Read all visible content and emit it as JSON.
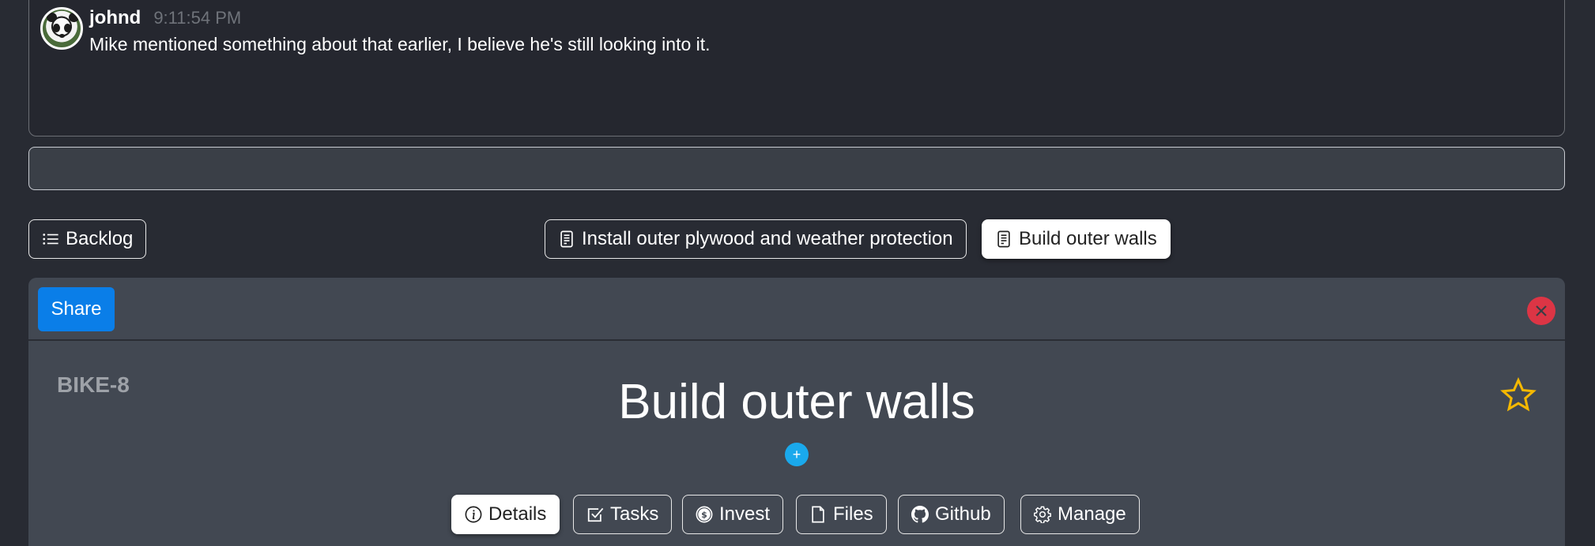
{
  "chat": {
    "message": {
      "username": "johnd",
      "time": "9:11:54 PM",
      "text": "Mike mentioned something about that earlier, I believe he's still looking into it.",
      "avatar": "panda-avatar"
    },
    "input": {
      "value": "",
      "placeholder": ""
    }
  },
  "nav": {
    "backlog_label": "Backlog",
    "tabs": [
      {
        "label": "Install outer plywood and weather protection",
        "icon": "document-icon",
        "active": false
      },
      {
        "label": "Build outer walls",
        "icon": "document-icon",
        "active": true
      }
    ]
  },
  "panel": {
    "share_label": "Share",
    "issue_key": "BIKE-8",
    "title": "Build outer walls",
    "add_label": "+",
    "starred": false,
    "colors": {
      "share": "#0a7ee8",
      "close": "#dc3545",
      "star": "#f5b800",
      "add": "#1aa9ec"
    },
    "subtabs": [
      {
        "label": "Details",
        "icon": "info-icon",
        "active": true
      },
      {
        "label": "Tasks",
        "icon": "checkbox-icon",
        "active": false
      },
      {
        "label": "Invest",
        "icon": "coin-icon",
        "active": false
      },
      {
        "label": "Files",
        "icon": "file-icon",
        "active": false
      },
      {
        "label": "Github",
        "icon": "github-icon",
        "active": false
      },
      {
        "label": "Manage",
        "icon": "gear-icon",
        "active": false
      }
    ]
  }
}
